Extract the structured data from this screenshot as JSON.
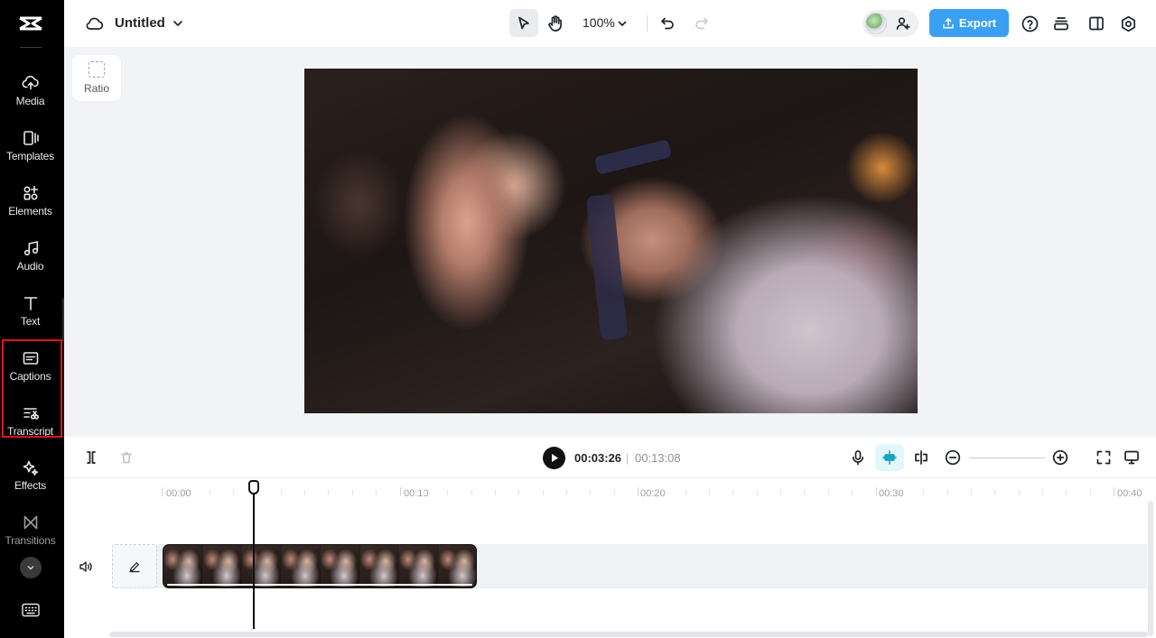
{
  "sidebar": {
    "items": [
      {
        "label": "Media",
        "icon": "cloud-upload-icon"
      },
      {
        "label": "Templates",
        "icon": "templates-icon"
      },
      {
        "label": "Elements",
        "icon": "elements-icon"
      },
      {
        "label": "Audio",
        "icon": "music-note-icon"
      },
      {
        "label": "Text",
        "icon": "text-t-icon"
      },
      {
        "label": "Captions",
        "icon": "captions-icon"
      },
      {
        "label": "Transcript",
        "icon": "transcript-icon"
      },
      {
        "label": "Effects",
        "icon": "sparkle-icon"
      },
      {
        "label": "Transitions",
        "icon": "transition-icon"
      }
    ]
  },
  "header": {
    "title": "Untitled",
    "zoom": "100%",
    "export_label": "Export"
  },
  "canvas": {
    "ratio_label": "Ratio"
  },
  "player": {
    "current_time": "00:03:26",
    "separator": "|",
    "total_time": "00:13:08"
  },
  "timeline": {
    "ruler": [
      "00:00",
      "00:10",
      "00:20",
      "00:30",
      "00:40"
    ]
  },
  "colors": {
    "accent": "#3aa0f3",
    "highlight": "#e3121b",
    "sidebar_bg": "#000000"
  }
}
